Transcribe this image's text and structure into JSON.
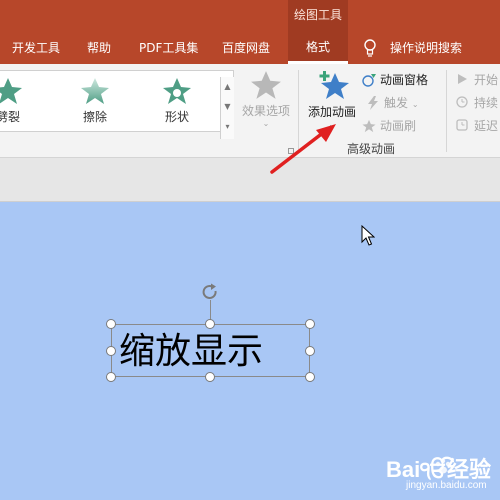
{
  "tabs": {
    "context_group": "绘图工具",
    "items": [
      "开发工具",
      "帮助",
      "PDF工具集",
      "百度网盘"
    ],
    "active": "格式",
    "tell_me": "操作说明搜索"
  },
  "ribbon": {
    "gallery": {
      "items": [
        {
          "label": "劈裂",
          "icon": "split-star-icon"
        },
        {
          "label": "擦除",
          "icon": "wipe-star-icon"
        },
        {
          "label": "形状",
          "icon": "shape-star-icon"
        }
      ]
    },
    "effect_options": {
      "label": "效果选项"
    },
    "advanced": {
      "add_animation": "添加动画",
      "animation_pane": "动画窗格",
      "trigger": "触发",
      "animation_painter": "动画刷",
      "group_label": "高级动画"
    },
    "timing": {
      "start": "开始",
      "duration": "持续",
      "delay": "延迟"
    }
  },
  "slide": {
    "textbox_text": "缩放显示"
  },
  "watermark": {
    "text": "Baiੴ经验",
    "url": "jingyan.baidu.com"
  },
  "colors": {
    "tab_bar": "#b7472a",
    "context_tab": "#a03b22",
    "slide_bg": "#a9c7f5",
    "star_green": "#4f9e85",
    "star_blue": "#3f7fc8",
    "arrow_red": "#e02020"
  }
}
